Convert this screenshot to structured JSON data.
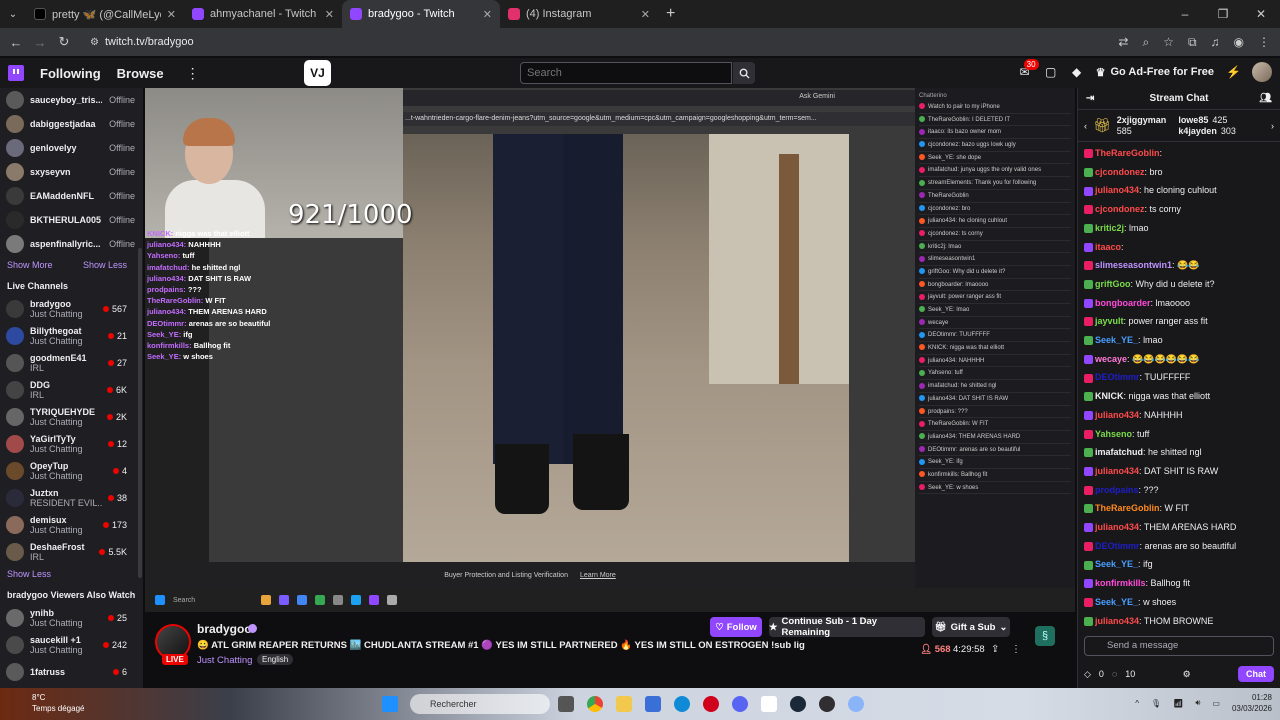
{
  "browser": {
    "tabs": [
      {
        "title": "pretty 🦋 (@CallMeLyci) / X",
        "color": "#000000"
      },
      {
        "title": "ahmyachanel - Twitch",
        "color": "#9146ff"
      },
      {
        "title": "bradygoo - Twitch",
        "color": "#9146ff",
        "active": true
      },
      {
        "title": "(4) Instagram",
        "color": "#e1306c"
      }
    ],
    "new_tab": "+",
    "url": "twitch.tv/bradygoo",
    "window_controls": [
      "–",
      "❐",
      "✕"
    ]
  },
  "topnav": {
    "following": "Following",
    "browse": "Browse",
    "more": "⋮",
    "vj_logo": "VJ",
    "search_placeholder": "Search",
    "notif_count": "30",
    "adfree_label": "Go Ad-Free for Free"
  },
  "sidebar": {
    "followed_offline": [
      {
        "name": "sauceyboy_tris...",
        "status": "Offline",
        "color": "#5a5a5a"
      },
      {
        "name": "dabiggestjadaa",
        "status": "Offline",
        "color": "#7a6a5a"
      },
      {
        "name": "genlovelyy",
        "status": "Offline",
        "color": "#6a6a7a"
      },
      {
        "name": "sxyseyvn",
        "status": "Offline",
        "color": "#8a7a6a"
      },
      {
        "name": "EAMaddenNFL",
        "status": "Offline",
        "color": "#3a3a3a"
      },
      {
        "name": "BKTHERULA005",
        "status": "Offline",
        "color": "#2a2a2a"
      },
      {
        "name": "aspenfinallyric...",
        "status": "Offline",
        "color": "#7a7a7a"
      }
    ],
    "show_more": "Show More",
    "show_less": "Show Less",
    "live_heading": "Live Channels",
    "live_channels": [
      {
        "name": "bradygoo",
        "category": "Just Chatting",
        "viewers": "567",
        "color": "#3a3a3a"
      },
      {
        "name": "Billythegoat",
        "category": "Just Chatting",
        "viewers": "21",
        "color": "#2d4aa0"
      },
      {
        "name": "goodmenE41",
        "category": "IRL",
        "viewers": "27",
        "color": "#555"
      },
      {
        "name": "DDG",
        "category": "IRL",
        "viewers": "6K",
        "color": "#444"
      },
      {
        "name": "TYRIQUEHYDE",
        "category": "Just Chatting",
        "viewers": "2K",
        "color": "#666"
      },
      {
        "name": "YaGirlTyTy",
        "category": "Just Chatting",
        "viewers": "12",
        "color": "#a04a4a"
      },
      {
        "name": "OpeyTup",
        "category": "Just Chatting",
        "viewers": "4",
        "color": "#6a4a2a"
      },
      {
        "name": "Juztxn",
        "category": "RESIDENT EVIL...",
        "viewers": "38",
        "color": "#2a2a3a"
      },
      {
        "name": "demisux",
        "category": "Just Chatting",
        "viewers": "173",
        "color": "#8a6a5a"
      },
      {
        "name": "DeshaeFrost",
        "category": "IRL",
        "viewers": "5.5K",
        "color": "#6a5a4a"
      }
    ],
    "show_less_live": "Show Less",
    "also_watch_heading": "bradygoo Viewers Also Watch",
    "also_watch": [
      {
        "name": "ynihb",
        "category": "Just Chatting",
        "viewers": "25",
        "color": "#6a6a6a"
      },
      {
        "name": "saucekill +1",
        "category": "Just Chatting",
        "viewers": "242",
        "color": "#4a4a4a"
      },
      {
        "name": "1fatruss",
        "category": "",
        "viewers": "6",
        "color": "#5a5a5a"
      }
    ]
  },
  "video": {
    "counter": "921/1000",
    "inner_url": "...t-wahntrieden-cargo-flare-denim-jeans?utm_source=google&utm_medium=cpc&utm_campaign=googleshopping&utm_term=sem...",
    "ask_gemini": "Ask Gemini",
    "footer_text": "Buyer Protection and Listing Verification",
    "footer_link": "Learn More",
    "taskbar_search": "Search",
    "overlay_chat": [
      {
        "user": "KNICK:",
        "text": "nigga was that elliott"
      },
      {
        "user": "juliano434:",
        "text": "NAHHHH"
      },
      {
        "user": "Yahseno:",
        "text": "tuff"
      },
      {
        "user": "imafatchud:",
        "text": "he shitted ngl"
      },
      {
        "user": "juliano434:",
        "text": "DAT SHIT IS RAW"
      },
      {
        "user": "prodpains:",
        "text": "???"
      },
      {
        "user": "TheRareGoblin:",
        "text": "W FIT"
      },
      {
        "user": "juliano434:",
        "text": "THEM ARENAS HARD"
      },
      {
        "user": "DEOtimmr:",
        "text": "arenas are so beautiful"
      },
      {
        "user": "Seek_YE:",
        "text": "ifg"
      },
      {
        "user": "konfirmkills:",
        "text": "Ballhog fit"
      },
      {
        "user": "Seek_YE:",
        "text": "w shoes"
      }
    ],
    "stream_chat_title": "Chatterino",
    "stream_chat_lines": [
      "Watch to pair to my iPhone",
      "TheRareGoblin: I DELETED IT",
      "itaaco: its bazo owner mom",
      "cjcondonez: bazo uggs lowk ugly",
      "Seek_YE: she dope",
      "imafatchud: junya uggs the only valid ones",
      "streamElements: Thank you for following",
      "TheRareGoblin",
      "cjcondonez: bro",
      "juliano434: he cloning cuhlout",
      "cjcondonez: ts corny",
      "kritic2j: lmao",
      "slimeseasontwin1",
      "griftGoo: Why did u delete it?",
      "bongboarder: lmaoooo",
      "jayvult: power ranger ass fit",
      "Seek_YE: lmao",
      "wecaye",
      "DEOtimmr: TUUFFFFF",
      "KNICK: nigga was that elliott",
      "juliano434: NAHHHH",
      "Yahseno: tuff",
      "imafatchud: he shitted ngl",
      "juliano434: DAT SHIT IS RAW",
      "prodpains: ???",
      "TheRareGoblin: W FIT",
      "juliano434: THEM ARENAS HARD",
      "DEOtimmr: arenas are so beautiful",
      "Seek_YE: ifg",
      "konfirmkills: Ballhog fit",
      "Seek_YE: w shoes"
    ]
  },
  "stream": {
    "name": "bradygoo",
    "live": "LIVE",
    "title": "😀 ATL GRIM REAPER RETURNS 🏙️ CHUDLANTA STREAM #1 🟣 YES IM STILL PARTNERED 🔥 YES IM STILL ON ESTROGEN !sub lig",
    "category": "Just Chatting",
    "language": "English",
    "follow": "Follow",
    "sub": "Continue Sub - 1 Day Remaining",
    "gift": "Gift a Sub",
    "viewers": "568",
    "uptime": "4:29:58"
  },
  "chat": {
    "title": "Stream Chat",
    "gifters": [
      {
        "name": "2xjiggyman",
        "count": "585"
      },
      {
        "name": "lowe85",
        "count": "425"
      },
      {
        "name": "k4jayden",
        "count": "303"
      }
    ],
    "messages": [
      {
        "user": "TheRareGoblin",
        "text": "",
        "color": "#ff4a4a"
      },
      {
        "user": "cjcondonez",
        "text": "bro",
        "color": "#ff4a4a"
      },
      {
        "user": "juliano434",
        "text": "he cloning cuhlout",
        "color": "#ff4a4a"
      },
      {
        "user": "cjcondonez",
        "text": "ts corny",
        "color": "#ff4a4a"
      },
      {
        "user": "kritic2j",
        "text": "lmao",
        "color": "#7bdc4a"
      },
      {
        "user": "itaaco",
        "text": "",
        "color": "#ff4a4a"
      },
      {
        "user": "slimeseasontwin1",
        "text": "😂😂",
        "color": "#bf94ff"
      },
      {
        "user": "griftGoo",
        "text": "Why did u delete it?",
        "color": "#7bdc4a"
      },
      {
        "user": "bongboarder",
        "text": "lmaoooo",
        "color": "#ff4ad9"
      },
      {
        "user": "jayvult",
        "text": "power ranger ass fit",
        "color": "#7bdc4a"
      },
      {
        "user": "Seek_YE_",
        "text": "lmao",
        "color": "#4a9eff"
      },
      {
        "user": "wecaye",
        "text": "😂😂😂😂😂😂",
        "color": "#ff7ad9"
      },
      {
        "user": "DEOtimmr",
        "text": "TUUFFFFF",
        "color": "#1e1ec8"
      },
      {
        "user": "KNICK",
        "text": "nigga was that elliott",
        "color": "#efeff1"
      },
      {
        "user": "juliano434",
        "text": "NAHHHH",
        "color": "#ff4a4a"
      },
      {
        "user": "Yahseno",
        "text": "tuff",
        "color": "#7bdc4a"
      },
      {
        "user": "imafatchud",
        "text": "he shitted ngl",
        "color": "#efeff1"
      },
      {
        "user": "juliano434",
        "text": "DAT SHIT IS RAW",
        "color": "#ff4a4a"
      },
      {
        "user": "prodpains",
        "text": "???",
        "color": "#1e1ec8"
      },
      {
        "user": "TheRareGoblin",
        "text": "W FIT",
        "color": "#ff8a1e"
      },
      {
        "user": "juliano434",
        "text": "THEM ARENAS HARD",
        "color": "#ff4a4a"
      },
      {
        "user": "DEOtimmr",
        "text": "arenas are so beautiful",
        "color": "#1e1ec8"
      },
      {
        "user": "Seek_YE_",
        "text": "ifg",
        "color": "#4a9eff"
      },
      {
        "user": "konfirmkills",
        "text": "Ballhog fit",
        "color": "#ff4ad9"
      },
      {
        "user": "Seek_YE_",
        "text": "w shoes",
        "color": "#4a9eff"
      },
      {
        "user": "juliano434",
        "text": "THOM BROWNE",
        "color": "#ff4a4a"
      }
    ],
    "input_placeholder": "Send a message",
    "points": "0",
    "channel_points": "10",
    "chat_button": "Chat"
  },
  "taskbar": {
    "weather_temp": "8°C",
    "weather_desc": "Temps dégagé",
    "search": "Rechercher",
    "time": "01:28",
    "date": "03/03/2026"
  }
}
